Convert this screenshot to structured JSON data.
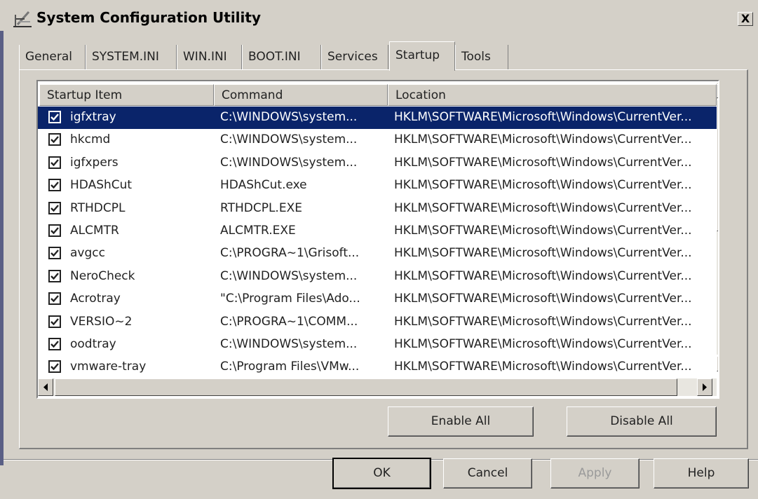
{
  "window": {
    "title": "System Configuration Utility",
    "close_glyph": "X"
  },
  "tabs": [
    {
      "label": "General",
      "selected": false
    },
    {
      "label": "SYSTEM.INI",
      "selected": false
    },
    {
      "label": "WIN.INI",
      "selected": false
    },
    {
      "label": "BOOT.INI",
      "selected": false
    },
    {
      "label": "Services",
      "selected": false
    },
    {
      "label": "Startup",
      "selected": true
    },
    {
      "label": "Tools",
      "selected": false
    }
  ],
  "list": {
    "columns": [
      "Startup Item",
      "Command",
      "Location"
    ],
    "rows": [
      {
        "item": "igfxtray",
        "command": "C:\\WINDOWS\\system...",
        "location": "HKLM\\SOFTWARE\\Microsoft\\Windows\\CurrentVer...",
        "checked": true,
        "selected": true
      },
      {
        "item": "hkcmd",
        "command": "C:\\WINDOWS\\system...",
        "location": "HKLM\\SOFTWARE\\Microsoft\\Windows\\CurrentVer...",
        "checked": true,
        "selected": false
      },
      {
        "item": "igfxpers",
        "command": "C:\\WINDOWS\\system...",
        "location": "HKLM\\SOFTWARE\\Microsoft\\Windows\\CurrentVer...",
        "checked": true,
        "selected": false
      },
      {
        "item": "HDAShCut",
        "command": "HDAShCut.exe",
        "location": "HKLM\\SOFTWARE\\Microsoft\\Windows\\CurrentVer...",
        "checked": true,
        "selected": false
      },
      {
        "item": "RTHDCPL",
        "command": "RTHDCPL.EXE",
        "location": "HKLM\\SOFTWARE\\Microsoft\\Windows\\CurrentVer...",
        "checked": true,
        "selected": false
      },
      {
        "item": "ALCMTR",
        "command": "ALCMTR.EXE",
        "location": "HKLM\\SOFTWARE\\Microsoft\\Windows\\CurrentVer...",
        "checked": true,
        "selected": false
      },
      {
        "item": "avgcc",
        "command": "C:\\PROGRA~1\\Grisoft...",
        "location": "HKLM\\SOFTWARE\\Microsoft\\Windows\\CurrentVer...",
        "checked": true,
        "selected": false
      },
      {
        "item": "NeroCheck",
        "command": "C:\\WINDOWS\\system...",
        "location": "HKLM\\SOFTWARE\\Microsoft\\Windows\\CurrentVer...",
        "checked": true,
        "selected": false
      },
      {
        "item": "Acrotray",
        "command": "\"C:\\Program Files\\Ado...",
        "location": "HKLM\\SOFTWARE\\Microsoft\\Windows\\CurrentVer...",
        "checked": true,
        "selected": false
      },
      {
        "item": "VERSIO~2",
        "command": "C:\\PROGRA~1\\COMM...",
        "location": "HKLM\\SOFTWARE\\Microsoft\\Windows\\CurrentVer...",
        "checked": true,
        "selected": false
      },
      {
        "item": "oodtray",
        "command": "C:\\WINDOWS\\system...",
        "location": "HKLM\\SOFTWARE\\Microsoft\\Windows\\CurrentVer...",
        "checked": true,
        "selected": false
      },
      {
        "item": "vmware-tray",
        "command": "C:\\Program Files\\VMw...",
        "location": "HKLM\\SOFTWARE\\Microsoft\\Windows\\CurrentVer...",
        "checked": true,
        "selected": false
      }
    ]
  },
  "buttons": {
    "enable_all": "Enable All",
    "disable_all": "Disable All",
    "ok": "OK",
    "cancel": "Cancel",
    "apply": "Apply",
    "help": "Help"
  },
  "icons": {
    "app": "msconfig-icon",
    "checkbox": "checkmark-icon",
    "scroll_up": "triangle-up-icon",
    "scroll_down": "triangle-down-icon",
    "scroll_left": "triangle-left-icon",
    "scroll_right": "triangle-right-icon"
  },
  "colors": {
    "face": "#d4d0c8",
    "selection": "#0a246a",
    "text": "#222222"
  }
}
